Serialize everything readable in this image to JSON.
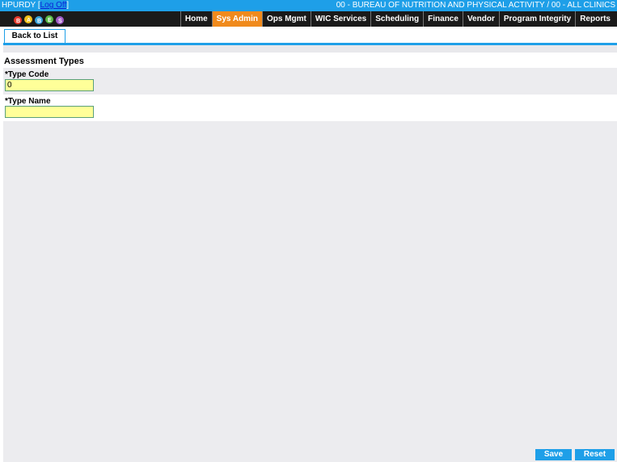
{
  "topbar": {
    "user": "HPURDY",
    "logoff": "Log Off",
    "organization": "00 - BUREAU OF NUTRITION AND PHYSICAL ACTIVITY / 00 - ALL CLINICS"
  },
  "nav": {
    "items": [
      "Home",
      "Sys Admin",
      "Ops Mgmt",
      "WIC Services",
      "Scheduling",
      "Finance",
      "Vendor",
      "Program Integrity",
      "Reports"
    ],
    "active": "Sys Admin"
  },
  "toolbar": {
    "back_label": "Back to List"
  },
  "form": {
    "title": "Assessment Types",
    "type_code_label": "*Type Code",
    "type_code_value": "0",
    "type_name_label": "*Type Name",
    "type_name_value": ""
  },
  "actions": {
    "save_label": "Save",
    "reset_label": "Reset"
  },
  "colors": {
    "accent": "#1e9fe8",
    "active_tab": "#f08a1c",
    "input_bg": "#ffff99"
  }
}
